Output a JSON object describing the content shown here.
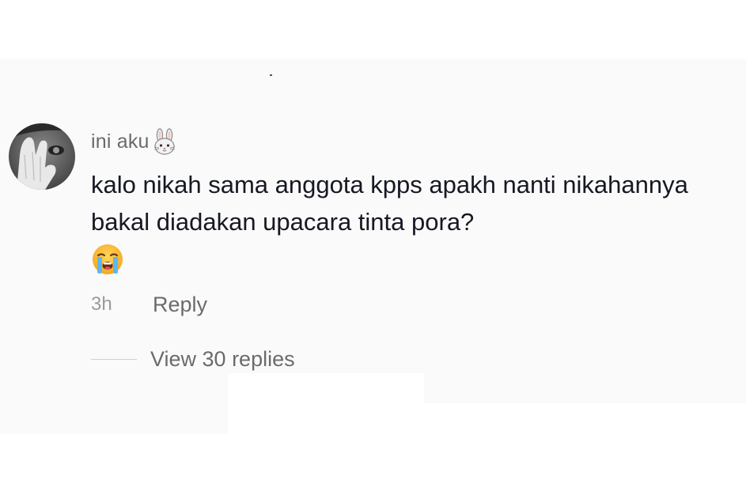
{
  "comment": {
    "username": "ini aku",
    "username_emoji": "bunny-face-icon",
    "text": "kalo nikah sama anggota kpps apakh nanti nikahannya bakal diadakan upacara tinta pora?",
    "text_emoji": "loudly-crying-face-icon",
    "timestamp": "3h",
    "reply_label": "Reply",
    "view_replies_label": "View 30 replies"
  },
  "colors": {
    "username": "#6b6b6b",
    "text": "#161823",
    "timestamp": "#9a9a9a",
    "action": "#6b6b6b",
    "background": "#fafafa"
  }
}
